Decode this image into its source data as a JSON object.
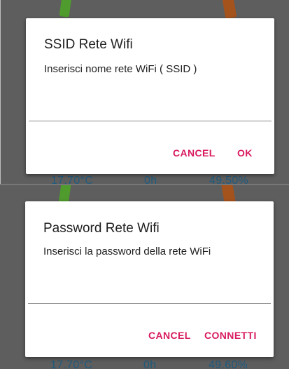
{
  "background": {
    "readings_top": [
      "17.70°C",
      "0h",
      "49.50%"
    ],
    "readings_bottom": [
      "17.70°C",
      "0h",
      "49.60%"
    ],
    "colors": {
      "dim_bg": "#5e5e5e",
      "gauge_green": "#4f9b2d",
      "gauge_orange": "#a5531d",
      "reading_text": "#1f5b7f"
    }
  },
  "ssid_dialog": {
    "title": "SSID Rete Wifi",
    "message": "Inserisci nome rete WiFi ( SSID )",
    "input_value": "",
    "cancel_label": "CANCEL",
    "ok_label": "OK"
  },
  "password_dialog": {
    "title": "Password Rete Wifi",
    "message": "Inserisci la password della rete WiFi",
    "input_value": "",
    "cancel_label": "CANCEL",
    "connect_label": "CONNETTI"
  },
  "accent_color": "#d81b60"
}
